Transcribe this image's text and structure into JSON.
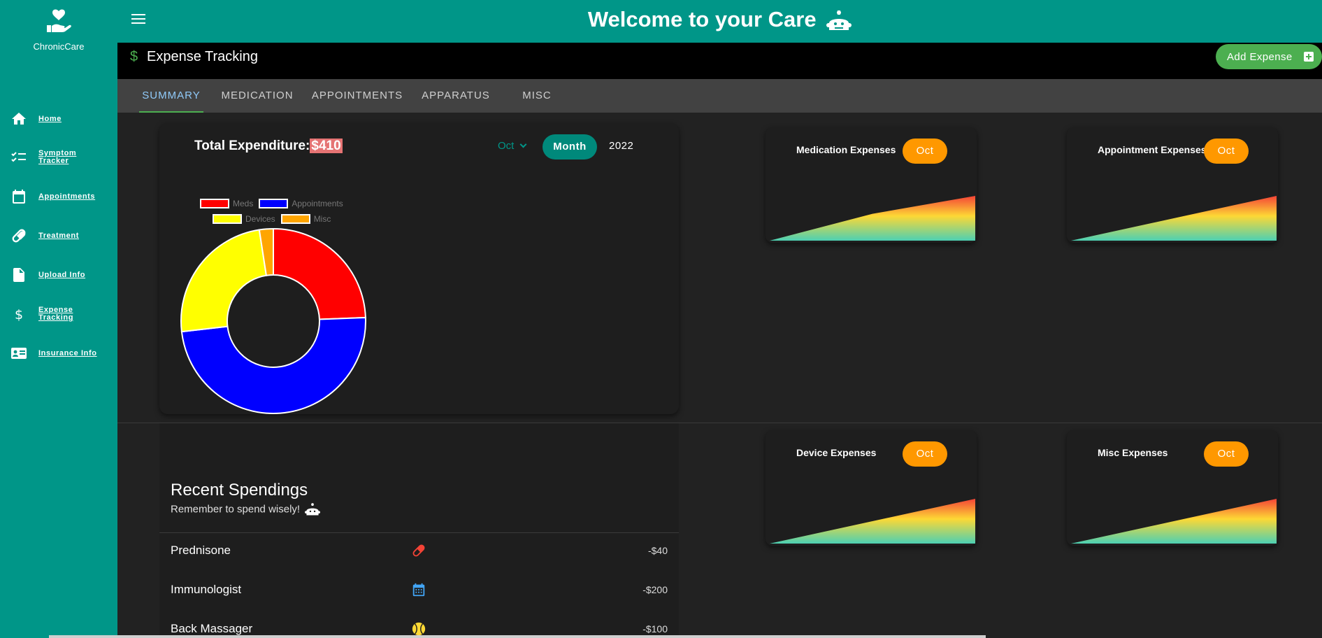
{
  "app": {
    "name": "ChronicCare"
  },
  "header": {
    "welcome": "Welcome to your Care"
  },
  "sidebar": {
    "items": [
      {
        "label": "Home",
        "icon": "home-icon"
      },
      {
        "label": "Symptom Tracker",
        "icon": "checklist-icon"
      },
      {
        "label": "Appointments",
        "icon": "calendar-icon"
      },
      {
        "label": "Treatment",
        "icon": "pill-icon"
      },
      {
        "label": "Upload Info",
        "icon": "upload-file-icon"
      },
      {
        "label": "Expense Tracking",
        "icon": "dollar-icon"
      },
      {
        "label": "Insurance Info",
        "icon": "id-card-icon"
      }
    ]
  },
  "expense": {
    "title": "Expense Tracking",
    "add_label": "Add Expense"
  },
  "tabs": [
    "SUMMARY",
    "MEDICATION",
    "APPOINTMENTS",
    "APPARATUS",
    "MISC"
  ],
  "summary": {
    "total_label": "Total Expenditure:",
    "total_value": "$410",
    "month": "Oct",
    "period": "Month",
    "year": "2022"
  },
  "chart_data": {
    "type": "pie",
    "categories": [
      "Meds",
      "Appointments",
      "Devices",
      "Misc"
    ],
    "values": [
      100,
      200,
      100,
      10
    ],
    "colors": [
      "#ff0000",
      "#0000ff",
      "#ffff00",
      "#ffa500"
    ],
    "legend_position": "top"
  },
  "mini_charts": [
    {
      "title": "Medication Expenses",
      "month": "Oct",
      "values": [
        0,
        60,
        100
      ]
    },
    {
      "title": "Appointment Expenses",
      "month": "Oct",
      "values": [
        0,
        50,
        100
      ]
    },
    {
      "title": "Device Expenses",
      "month": "Oct",
      "values": [
        0,
        50,
        100
      ]
    },
    {
      "title": "Misc Expenses",
      "month": "Oct",
      "values": [
        0,
        50,
        100
      ]
    }
  ],
  "recent": {
    "title": "Recent Spendings",
    "subtitle": "Remember to spend wisely!",
    "items": [
      {
        "name": "Prednisone",
        "icon": "pill-icon",
        "amount": "-$40"
      },
      {
        "name": "Immunologist",
        "icon": "calendar-icon",
        "amount": "-$200"
      },
      {
        "name": "Back Massager",
        "icon": "ball-icon",
        "amount": "-$100"
      }
    ]
  }
}
